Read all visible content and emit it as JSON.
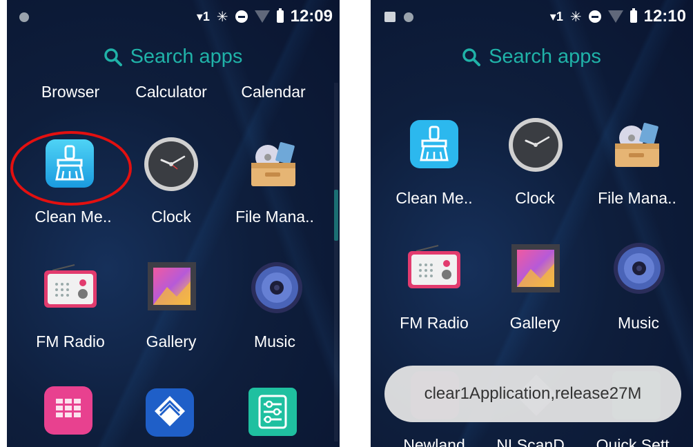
{
  "left": {
    "status": {
      "signal": "▾1",
      "bluetooth": "✳",
      "time": "12:09"
    },
    "search": {
      "placeholder": "Search apps"
    },
    "row_top_labels": [
      "Browser",
      "Calculator",
      "Calendar"
    ],
    "apps": [
      {
        "label": "Clean Me..",
        "icon": "broom-icon"
      },
      {
        "label": "Clock",
        "icon": "clock-icon"
      },
      {
        "label": "File Mana..",
        "icon": "folder-icon"
      },
      {
        "label": "FM Radio",
        "icon": "radio-icon"
      },
      {
        "label": "Gallery",
        "icon": "gallery-icon"
      },
      {
        "label": "Music",
        "icon": "speaker-icon"
      }
    ],
    "bottom_icons": [
      "grid-app-icon",
      "scan-diamond-icon",
      "settings-sliders-icon"
    ]
  },
  "right": {
    "status": {
      "signal": "▾1",
      "bluetooth": "✳",
      "time": "12:10"
    },
    "search": {
      "placeholder": "Search apps"
    },
    "apps": [
      {
        "label": "Clean Me..",
        "icon": "broom-icon"
      },
      {
        "label": "Clock",
        "icon": "clock-icon"
      },
      {
        "label": "File Mana..",
        "icon": "folder-icon"
      },
      {
        "label": "FM Radio",
        "icon": "radio-icon"
      },
      {
        "label": "Gallery",
        "icon": "gallery-icon"
      },
      {
        "label": "Music",
        "icon": "speaker-icon"
      }
    ],
    "toast": "clear1Application,release27M",
    "partial_labels": [
      "Newland",
      "NLScanD..",
      "Quick Sett.."
    ]
  },
  "colors": {
    "accent": "#20b2a8",
    "highlight_ring": "#e31010",
    "background": "#0e1e3c"
  }
}
